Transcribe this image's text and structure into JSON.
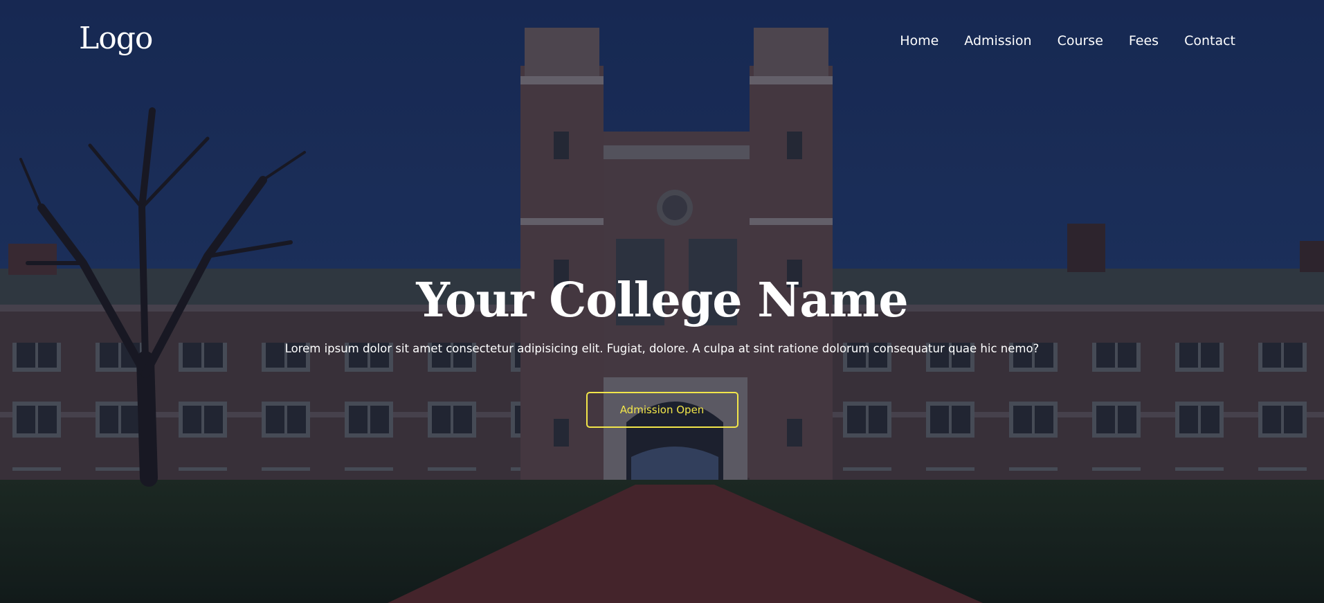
{
  "nav": {
    "logo": "Logo",
    "links": [
      {
        "label": "Home"
      },
      {
        "label": "Admission"
      },
      {
        "label": "Course"
      },
      {
        "label": "Fees"
      },
      {
        "label": "Contact"
      }
    ]
  },
  "hero": {
    "title": "Your College Name",
    "description": "Lorem ipsum dolor sit amet consectetur adipisicing elit. Fugiat, dolore. A culpa at sint ratione dolorum consequatur quae hic nemo?",
    "button_label": "Admission Open",
    "background_image": "college-building-photo"
  },
  "colors": {
    "text": "#ffffff",
    "accent": "#f2e64a",
    "sky": "#1f3466",
    "overlay": "#0c1630"
  }
}
